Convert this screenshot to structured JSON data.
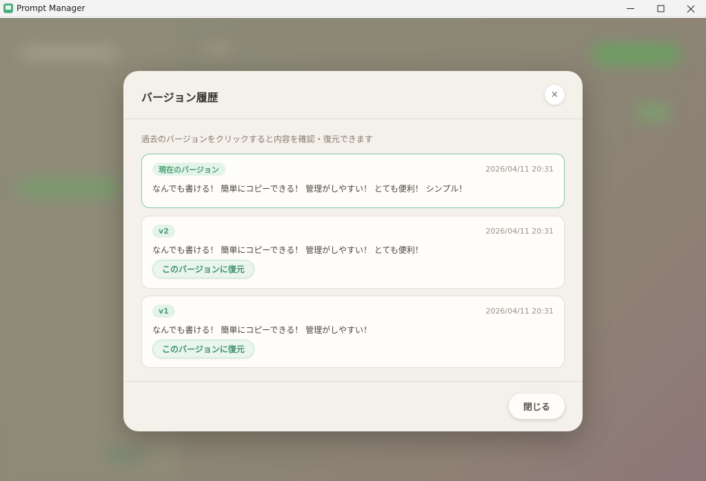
{
  "window": {
    "title": "Prompt Manager",
    "minimize": "—",
    "maximize": "☐",
    "close": "✕"
  },
  "dialog": {
    "title": "バージョン履歴",
    "close_icon": "×",
    "hint": "過去のバージョンをクリックすると内容を確認・復元できます",
    "versions": [
      {
        "badge": "現在のバージョン",
        "timestamp": "2026/04/11 20:31",
        "content": "なんでも書ける！ 簡単にコピーできる！ 管理がしやすい！ とても便利！ シンプル！",
        "is_current": true
      },
      {
        "badge": "v2",
        "timestamp": "2026/04/11 20:31",
        "content": "なんでも書ける！ 簡単にコピーできる！ 管理がしやすい！ とても便利！",
        "restore_label": "このバージョンに復元"
      },
      {
        "badge": "v1",
        "timestamp": "2026/04/11 20:31",
        "content": "なんでも書ける！ 簡単にコピーできる！ 管理がしやすい！",
        "restore_label": "このバージョンに復元"
      }
    ],
    "footer_close": "閉じる"
  },
  "colors": {
    "accent_green": "#4c9e72",
    "current_border": "#82c8a4",
    "modal_bg": "#f4f0ea"
  }
}
